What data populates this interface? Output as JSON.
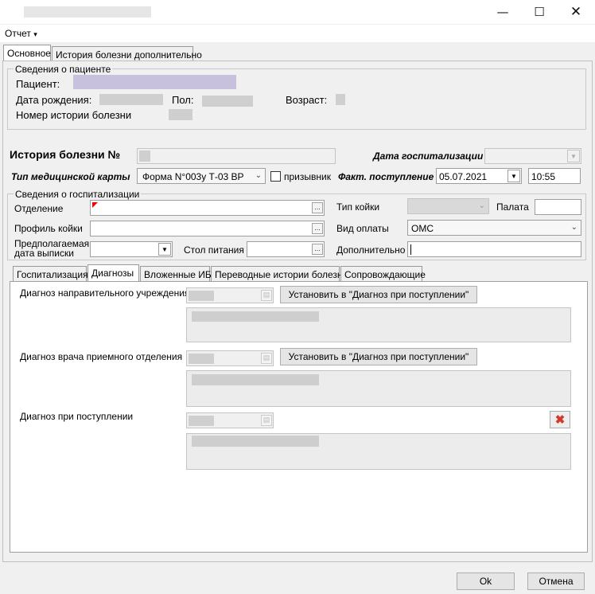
{
  "window": {
    "minimize_icon": "minimize-icon",
    "maximize_icon": "maximize-icon",
    "close_icon": "close-icon"
  },
  "menu": {
    "report_label": "Отчет",
    "report_arrow": "▾"
  },
  "tabs_top": [
    "Основное",
    "История болезни дополнительно"
  ],
  "patient": {
    "group_title": "Сведения о пациенте",
    "patient_label": "Пациент:",
    "birth_label": "Дата рождения:",
    "sex_label": "Пол:",
    "age_label": "Возраст:",
    "history_number_label": "Номер истории болезни"
  },
  "history": {
    "title": "История болезни №",
    "hosp_date_label": "Дата госпитализации",
    "card_type_label": "Тип медицинской карты",
    "card_type_value": "Форма N°003у Т-03 ВР",
    "conscript_label": "призывник",
    "actual_admission_label": "Факт. поступление",
    "actual_date": "05.07.2021",
    "actual_time": "10:55"
  },
  "hospitalization": {
    "group_title": "Сведения о госпитализации",
    "department_label": "Отделение",
    "bed_type_label": "Тип койки",
    "ward_label": "Палата",
    "bed_profile_label": "Профиль койки",
    "payment_type_label": "Вид оплаты",
    "payment_type_value": "ОМС",
    "discharge_label_1": "Предполагаемая",
    "discharge_label_2": "дата выписки",
    "meal_table_label": "Стол питания",
    "additional_label": "Дополнительно",
    "dots": "..."
  },
  "tabs_inner": [
    "Госпитализация",
    "Диагнозы",
    "Вложенные ИБ",
    "Переводные истории болезни",
    "Сопровождающие"
  ],
  "diagnoses": {
    "referral_label": "Диагноз направительного учреждения",
    "reception_label": "Диагноз врача приемного отделения",
    "admission_label": "Диагноз при поступлении",
    "set_button_1": "Установить в \"Диагноз при поступлении\"",
    "set_button_2": "Установить в \"Диагноз при поступлении\""
  },
  "footer": {
    "ok_label": "Ok",
    "cancel_label": "Отмена"
  }
}
